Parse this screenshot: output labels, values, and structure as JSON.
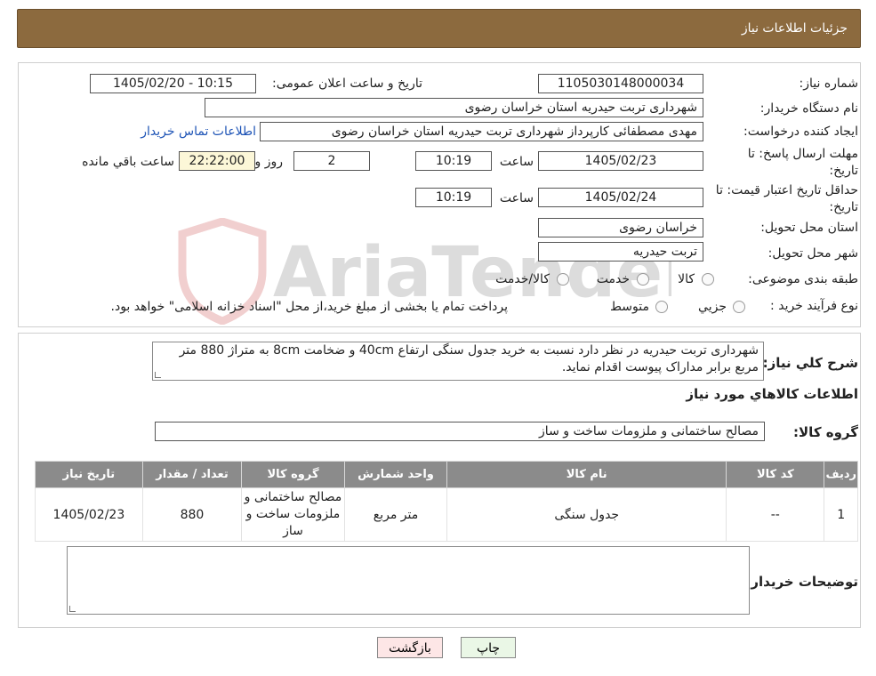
{
  "header": {
    "title": "جزئیات اطلاعات نیاز"
  },
  "form": {
    "need_number_label": "شماره نیاز:",
    "need_number": "1105030148000034",
    "announce_label": "تاریخ و ساعت اعلان عمومی:",
    "announce_value": "1405/02/20 - 10:15",
    "buyer_org_label": "نام دستگاه خریدار:",
    "buyer_org": "شهرداری تربت حیدریه استان خراسان رضوی",
    "creator_label": "ایجاد کننده درخواست:",
    "creator": "مهدی مصطفائی کارپرداز شهرداری تربت حیدریه استان خراسان رضوی",
    "contact_link": "اطلاعات تماس خریدار",
    "deadline_label_1": "مهلت ارسال پاسخ: تا",
    "deadline_label_2": "تاریخ:",
    "deadline_date": "1405/02/23",
    "time_label": "ساعت",
    "deadline_time": "10:19",
    "days_value": "2",
    "days_label": "روز و",
    "remaining_time": "22:22:00",
    "remaining_label": "ساعت باقي مانده",
    "validity_label_1": "حداقل تاریخ اعتبار قیمت: تا",
    "validity_label_2": "تاریخ:",
    "validity_date": "1405/02/24",
    "validity_time": "10:19",
    "province_label": "استان محل تحویل:",
    "province": "خراسان رضوی",
    "city_label": "شهر محل تحویل:",
    "city": "تربت حیدریه",
    "category_label": "طبقه بندی موضوعی:",
    "category_options": [
      "کالا",
      "خدمت",
      "کالا/خدمت"
    ],
    "process_label": "نوع فرآیند خرید :",
    "process_options": [
      "جزیي",
      "متوسط"
    ],
    "process_note": "پرداخت تمام یا بخشی از مبلغ خرید،از محل \"اسناد خزانه اسلامی\" خواهد بود."
  },
  "details": {
    "desc_label": "شرح کلي نياز:",
    "desc_text": "شهرداری تربت حیدریه در نظر دارد نسبت به خرید جدول سنگی ارتفاع 40cm  و ضخامت 8cm  به متراژ 880 متر مربع برابر مداراک پیوست اقدام نماید.",
    "goods_info_title": "اطلاعات کالاهاي مورد نياز",
    "goods_group_label": "گروه کالا:",
    "goods_group": "مصالح ساختمانی و ملزومات ساخت و ساز",
    "table_headers": [
      "رديف",
      "کد کالا",
      "نام کالا",
      "واحد شمارش",
      "گروه کالا",
      "تعداد / مقدار",
      "تاريخ نياز"
    ],
    "rows": [
      [
        "1",
        "--",
        "جدول سنگی",
        "متر مربع",
        "مصالح ساختمانی و ملزومات ساخت و ساز",
        "880",
        "1405/02/23"
      ]
    ],
    "buyer_notes_label": "توضیحات خریدار:",
    "buyer_notes": ""
  },
  "buttons": {
    "print": "چاپ",
    "back": "بازگشت"
  },
  "watermark": {
    "text": "AriaTender.neT"
  },
  "colors": {
    "header": "#8c6a3e",
    "table_header": "#8b8b8b",
    "highlight": "#fcf7d8",
    "link": "#1e54b6"
  }
}
